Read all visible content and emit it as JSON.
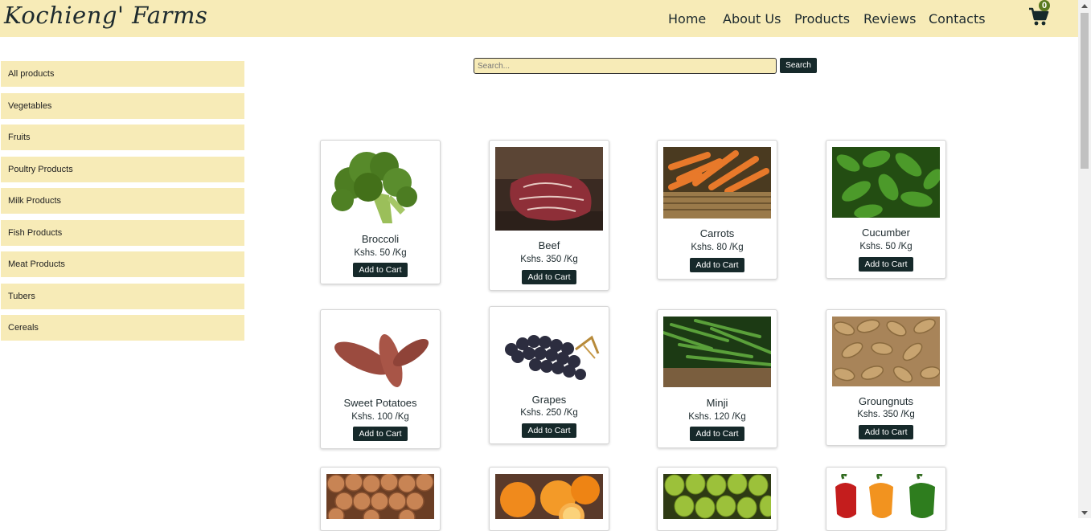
{
  "brand": {
    "logo_text": "Kochieng' Farms"
  },
  "nav": {
    "links": [
      "Home",
      "About Us",
      "Products",
      "Reviews",
      "Contacts"
    ],
    "cart_count": "0"
  },
  "sidebar": {
    "categories": [
      "All products",
      "Vegetables",
      "Fruits",
      "Poultry Products",
      "Milk Products",
      "Fish Products",
      "Meat Products",
      "Tubers",
      "Cereals"
    ]
  },
  "search": {
    "placeholder": "Search...",
    "button_label": "Search"
  },
  "products": [
    {
      "name": "Broccoli",
      "price": "Kshs. 50 /Kg",
      "button": "Add to Cart"
    },
    {
      "name": "Beef",
      "price": "Kshs. 350 /Kg",
      "button": "Add to Cart"
    },
    {
      "name": "Carrots",
      "price": "Kshs. 80 /Kg",
      "button": "Add to Cart"
    },
    {
      "name": "Cucumber",
      "price": "Kshs. 50 /Kg",
      "button": "Add to Cart"
    },
    {
      "name": "Sweet Potatoes",
      "price": "Kshs. 100 /Kg",
      "button": "Add to Cart"
    },
    {
      "name": "Grapes",
      "price": "Kshs. 250 /Kg",
      "button": "Add to Cart"
    },
    {
      "name": "Minji",
      "price": "Kshs. 120 /Kg",
      "button": "Add to Cart"
    },
    {
      "name": "Groungnuts",
      "price": "Kshs. 350 /Kg",
      "button": "Add to Cart"
    }
  ],
  "colors": {
    "header_bg": "#f7ebb7",
    "button_bg": "#16292a",
    "cart_badge": "#5a7a1f"
  }
}
